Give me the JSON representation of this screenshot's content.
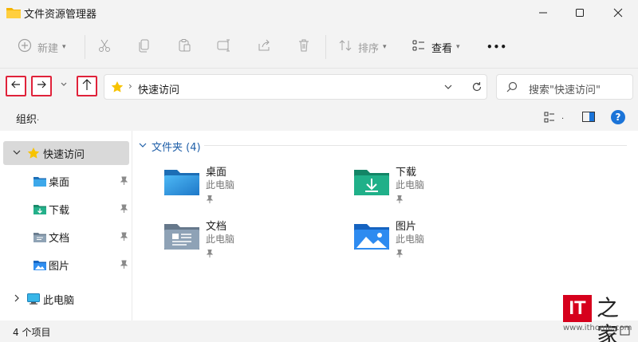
{
  "window": {
    "title": "文件资源管理器"
  },
  "toolbar": {
    "new_label": "新建",
    "sort_label": "排序",
    "view_label": "查看",
    "more_label": "•••"
  },
  "address": {
    "location": "快速访问",
    "search_placeholder": "搜索\"快速访问\""
  },
  "commandbar": {
    "organize_label": "组织"
  },
  "sidebar": {
    "items": [
      {
        "label": "快速访问",
        "icon": "star-icon"
      },
      {
        "label": "桌面",
        "icon": "desktop-folder-icon"
      },
      {
        "label": "下载",
        "icon": "downloads-folder-icon"
      },
      {
        "label": "文档",
        "icon": "documents-folder-icon"
      },
      {
        "label": "图片",
        "icon": "pictures-folder-icon"
      },
      {
        "label": "此电脑",
        "icon": "computer-icon"
      }
    ]
  },
  "content": {
    "group_title": "文件夹 (4)",
    "tiles": [
      {
        "name": "桌面",
        "sub": "此电脑",
        "icon": "desktop-folder-icon"
      },
      {
        "name": "下载",
        "sub": "此电脑",
        "icon": "downloads-folder-icon"
      },
      {
        "name": "文档",
        "sub": "此电脑",
        "icon": "documents-folder-icon"
      },
      {
        "name": "图片",
        "sub": "此电脑",
        "icon": "pictures-folder-icon"
      }
    ]
  },
  "status": {
    "item_count": "4 个项目"
  },
  "watermark": {
    "brand": "IT",
    "home": "之家",
    "url": "www.ithome.com"
  },
  "colors": {
    "accent": "#1b74d8",
    "highlight_border": "#e0223a",
    "brand_red": "#d6001c"
  }
}
